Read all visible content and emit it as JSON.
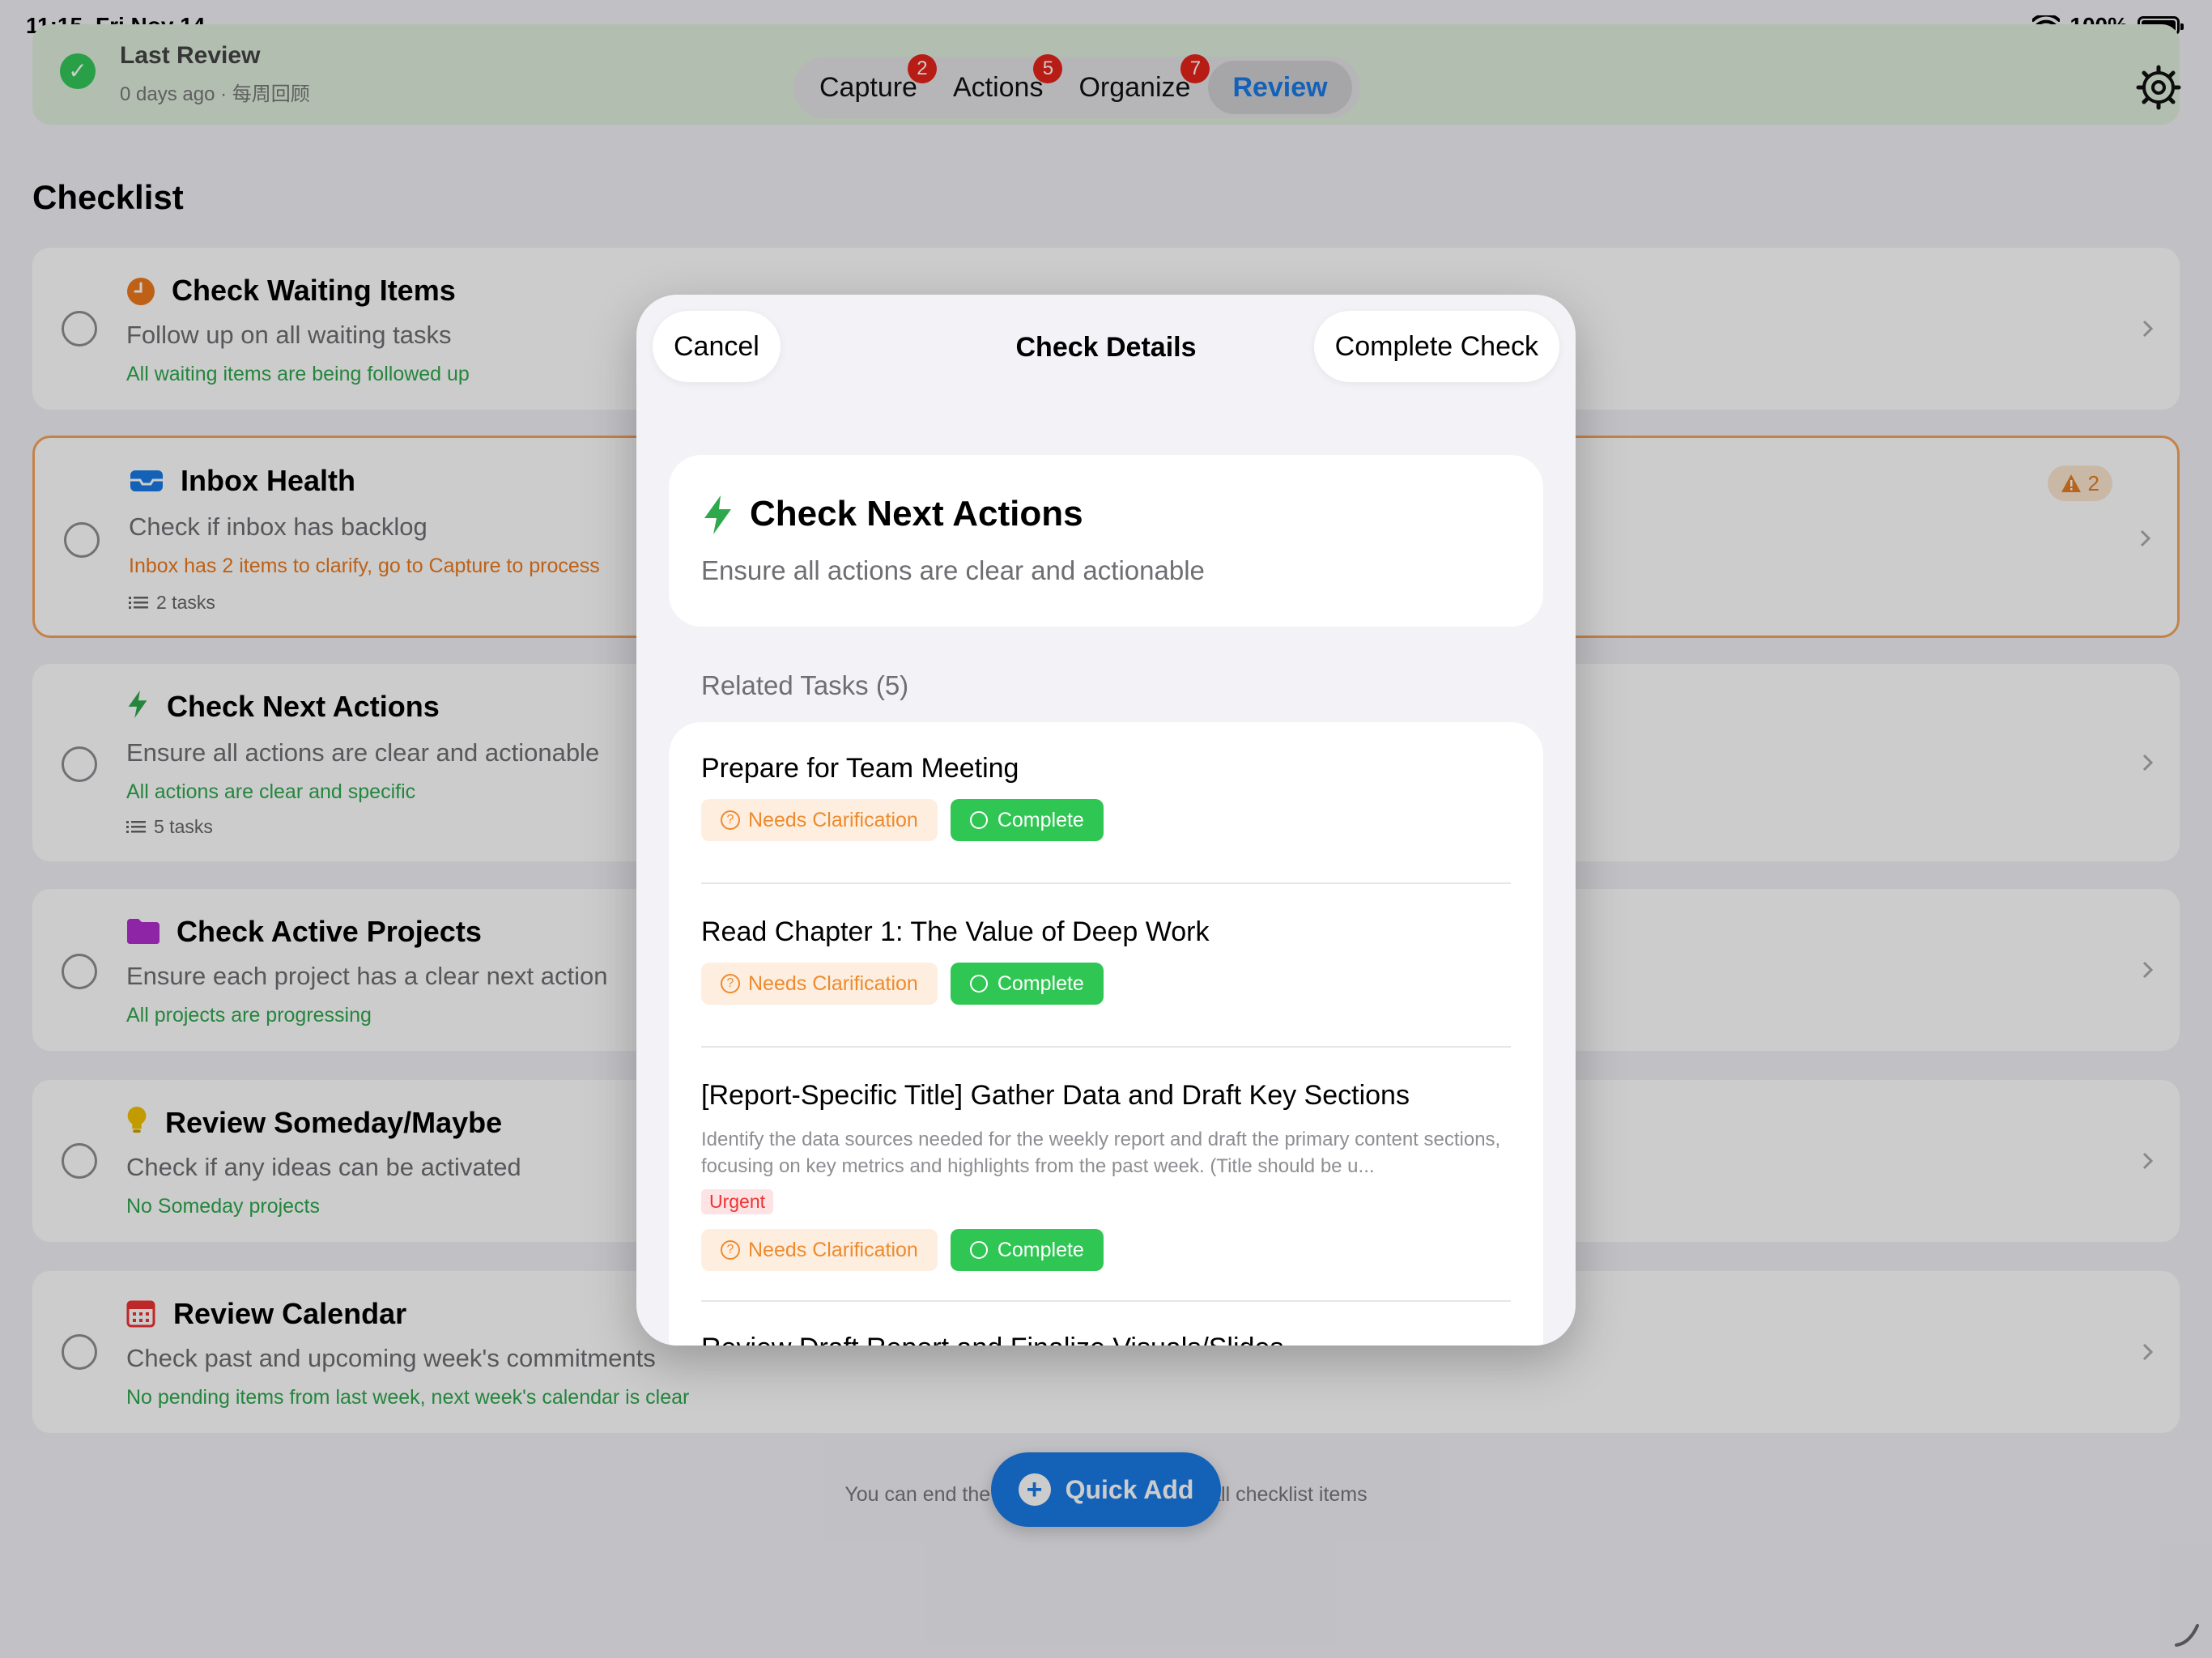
{
  "status_bar": {
    "time": "11:15",
    "date": "Fri Nov 14",
    "battery": "100%"
  },
  "banner": {
    "title": "Last Review",
    "subtitle": "0 days ago · 每周回顾"
  },
  "tabs": [
    {
      "label": "Capture",
      "badge": "2"
    },
    {
      "label": "Actions",
      "badge": "5"
    },
    {
      "label": "Organize",
      "badge": "7"
    },
    {
      "label": "Review",
      "badge": ""
    }
  ],
  "checklist": {
    "title": "Checklist",
    "items": [
      {
        "title": "Check Waiting Items",
        "desc": "Follow up on all waiting tasks",
        "status": "All waiting items are being followed up",
        "count": ""
      },
      {
        "title": "Inbox Health",
        "desc": "Check if inbox has backlog",
        "status": "Inbox has 2 items to clarify, go to Capture to process",
        "count": "2 tasks",
        "warn_count": "2"
      },
      {
        "title": "Check Next Actions",
        "desc": "Ensure all actions are clear and actionable",
        "status": "All actions are clear and specific",
        "count": "5 tasks"
      },
      {
        "title": "Check Active Projects",
        "desc": "Ensure each project has a clear next action",
        "status": "All projects are progressing",
        "count": ""
      },
      {
        "title": "Review Someday/Maybe",
        "desc": "Check if any ideas can be activated",
        "status": "No Someday projects",
        "count": ""
      },
      {
        "title": "Review Calendar",
        "desc": "Check past and upcoming week's commitments",
        "status": "No pending items from last week, next week's calendar is clear",
        "count": ""
      }
    ]
  },
  "footer_note": "You can end the review after completing all checklist items",
  "quick_add": "Quick Add",
  "modal": {
    "cancel": "Cancel",
    "title": "Check Details",
    "complete": "Complete Check",
    "check_title": "Check Next Actions",
    "check_desc": "Ensure all actions are clear and actionable",
    "section": "Related Tasks (5)",
    "tasks": [
      {
        "title": "Prepare for Team Meeting",
        "desc": "",
        "tag": "",
        "clarify": "Needs Clarification",
        "complete": "Complete"
      },
      {
        "title": "Read Chapter 1: The Value of Deep Work",
        "desc": "",
        "tag": "",
        "clarify": "Needs Clarification",
        "complete": "Complete"
      },
      {
        "title": "[Report-Specific Title] Gather Data and Draft Key Sections",
        "desc": "Identify the data sources needed for the weekly report and draft the primary content sections, focusing on key metrics and highlights from the past week. (Title should be u...",
        "tag": "Urgent",
        "clarify": "Needs Clarification",
        "complete": "Complete"
      },
      {
        "title": "Review Draft Report and Finalize Visuals/Slides",
        "desc": "",
        "tag": "",
        "clarify": "",
        "complete": ""
      }
    ]
  },
  "colors": {
    "accent": "#1a7ae6",
    "success": "#2fc654",
    "warning": "#ee8a2c",
    "danger": "#e5231b"
  }
}
